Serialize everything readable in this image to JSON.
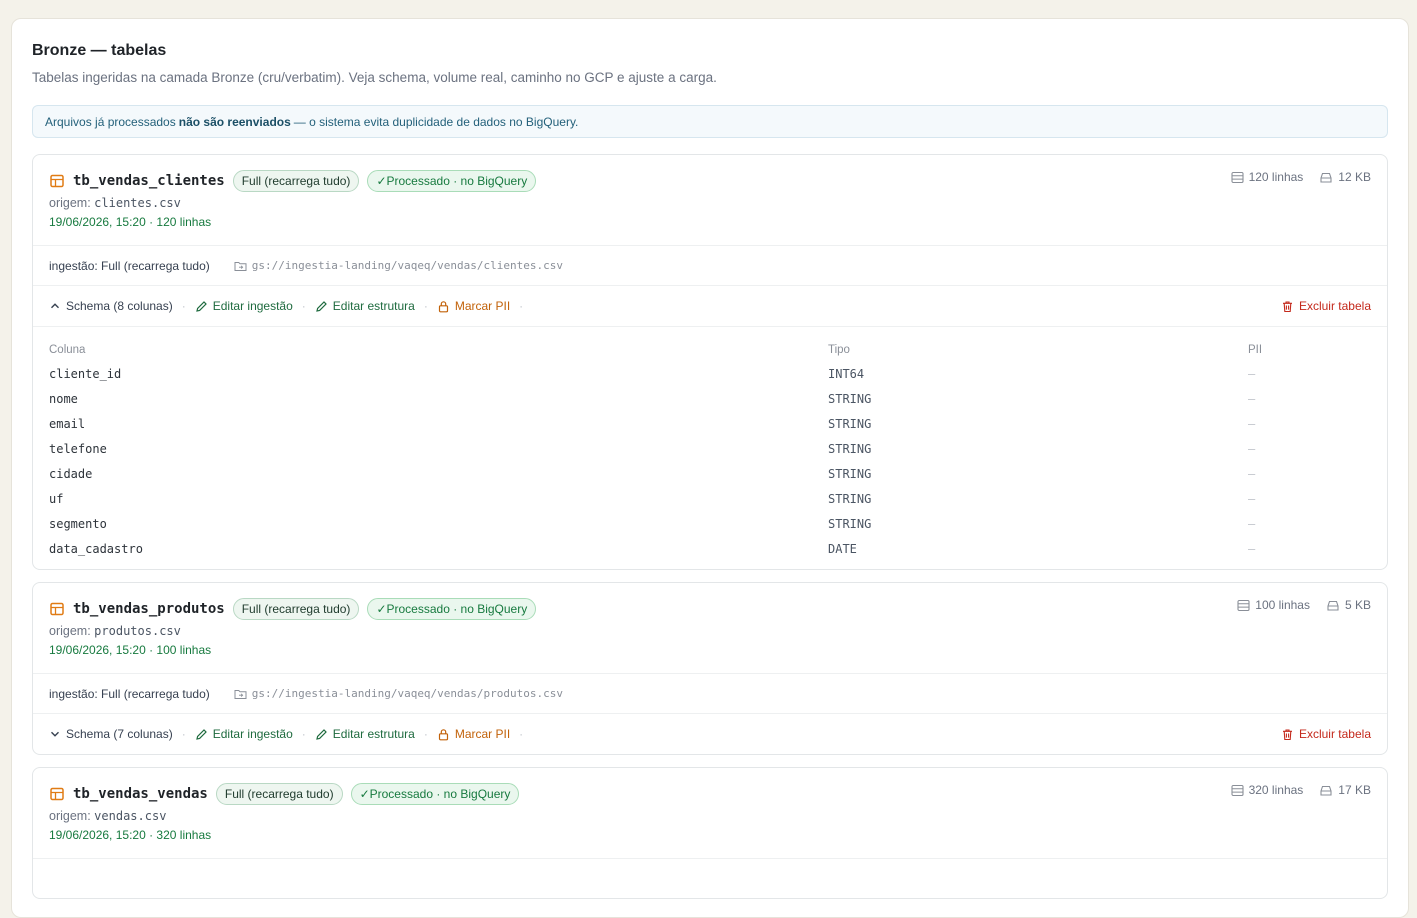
{
  "header": {
    "title": "Bronze — tabelas",
    "subtitle": "Tabelas ingeridas na camada Bronze (cru/verbatim). Veja schema, volume real, caminho no GCP e ajuste a carga."
  },
  "notice": {
    "prefix": "Arquivos já processados",
    "bold": "não são reenviados",
    "suffix": "— o sistema evita duplicidade de dados no BigQuery."
  },
  "colors": {
    "accent_green": "#177a3f",
    "accent_orange": "#c2620a",
    "danger": "#c4291c"
  },
  "tables": [
    {
      "name": "tb_vendas_clientes",
      "load_badge": "Full (recarrega tudo)",
      "status_badge": "✓Processado · no BigQuery",
      "rows_meta": "120 linhas",
      "size_meta": "12 KB",
      "origin_label": "origem:",
      "origin_file": "clientes.csv",
      "loaded_at": "19/06/2026, 15:20 · 120 linhas",
      "ingest_label": "ingestão: Full (recarrega tudo)",
      "gcs_path": "gs://ingestia-landing/vaqeq/vendas/clientes.csv",
      "schema_label": "Schema (8 colunas)",
      "expanded": true,
      "actions": {
        "edit_ingest": "Editar ingestão",
        "edit_structure": "Editar estrutura",
        "mark_pii": "Marcar PII",
        "delete": "Excluir tabela"
      },
      "schema_headers": {
        "column": "Coluna",
        "type": "Tipo",
        "pii": "PII"
      },
      "columns": [
        {
          "name": "cliente_id",
          "type": "INT64",
          "pii": "—"
        },
        {
          "name": "nome",
          "type": "STRING",
          "pii": "—"
        },
        {
          "name": "email",
          "type": "STRING",
          "pii": "—"
        },
        {
          "name": "telefone",
          "type": "STRING",
          "pii": "—"
        },
        {
          "name": "cidade",
          "type": "STRING",
          "pii": "—"
        },
        {
          "name": "uf",
          "type": "STRING",
          "pii": "—"
        },
        {
          "name": "segmento",
          "type": "STRING",
          "pii": "—"
        },
        {
          "name": "data_cadastro",
          "type": "DATE",
          "pii": "—"
        }
      ]
    },
    {
      "name": "tb_vendas_produtos",
      "load_badge": "Full (recarrega tudo)",
      "status_badge": "✓Processado · no BigQuery",
      "rows_meta": "100 linhas",
      "size_meta": "5 KB",
      "origin_label": "origem:",
      "origin_file": "produtos.csv",
      "loaded_at": "19/06/2026, 15:20 · 100 linhas",
      "ingest_label": "ingestão: Full (recarrega tudo)",
      "gcs_path": "gs://ingestia-landing/vaqeq/vendas/produtos.csv",
      "schema_label": "Schema (7 colunas)",
      "expanded": false,
      "actions": {
        "edit_ingest": "Editar ingestão",
        "edit_structure": "Editar estrutura",
        "mark_pii": "Marcar PII",
        "delete": "Excluir tabela"
      }
    },
    {
      "name": "tb_vendas_vendas",
      "load_badge": "Full (recarrega tudo)",
      "status_badge": "✓Processado · no BigQuery",
      "rows_meta": "320 linhas",
      "size_meta": "17 KB",
      "origin_label": "origem:",
      "origin_file": "vendas.csv",
      "loaded_at": "19/06/2026, 15:20 · 320 linhas"
    }
  ]
}
